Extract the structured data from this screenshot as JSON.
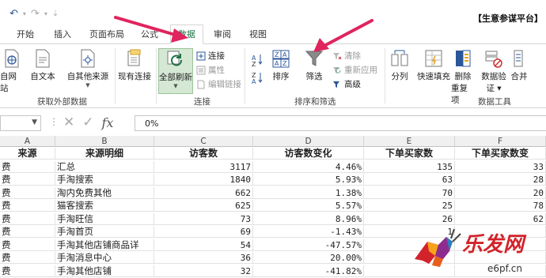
{
  "qat": {
    "undo": "↶",
    "redo": "↷",
    "customize": "⇣"
  },
  "app_title": "【生意参谋平台】",
  "tabs": [
    "开始",
    "插入",
    "页面布局",
    "公式",
    "数据",
    "审阅",
    "视图"
  ],
  "active_tab": "数据",
  "ribbon": {
    "get_external": {
      "buttons": [
        "自网站",
        "自文本",
        "自其他来源",
        "现有连接"
      ],
      "label": "获取外部数据"
    },
    "connections": {
      "refresh_all": "全部刷新",
      "connect": "连接",
      "properties": "属性",
      "edit_links": "编辑链接",
      "label": "连接"
    },
    "sort_filter": {
      "sort": "排序",
      "filter": "筛选",
      "clear": "清除",
      "reapply": "重新应用",
      "advanced": "高级",
      "label": "排序和筛选"
    },
    "data_tools": {
      "split": "分列",
      "flash_fill": "快速填充",
      "remove_dup_1": "删除",
      "remove_dup_2": "重复项",
      "validation_1": "数据验",
      "validation_2": "证 ▾",
      "consolidate": "合并",
      "label": "数据工具"
    }
  },
  "formula": {
    "value": "0%",
    "fx": "fx"
  },
  "columns": [
    "A",
    "B",
    "C",
    "D",
    "E",
    "F"
  ],
  "headers": [
    "来源",
    "来源明细",
    "访客数",
    "访客数变化",
    "下单买家数",
    "下单买家数变"
  ],
  "rows": [
    [
      "费",
      "汇总",
      "3117",
      "4.46%",
      "135",
      "33"
    ],
    [
      "费",
      "手淘搜索",
      "1840",
      "5.93%",
      "63",
      "28"
    ],
    [
      "费",
      "淘内免费其他",
      "662",
      "1.38%",
      "70",
      "20"
    ],
    [
      "费",
      "猫客搜索",
      "625",
      "5.57%",
      "25",
      "78"
    ],
    [
      "费",
      "手淘旺信",
      "73",
      "8.96%",
      "26",
      "62"
    ],
    [
      "费",
      "手淘首页",
      "69",
      "-1.43%",
      "1",
      ""
    ],
    [
      "费",
      "手淘其他店铺商品详",
      "54",
      "-47.57%",
      "",
      ""
    ],
    [
      "费",
      "手淘消息中心",
      "36",
      "20.00%",
      "",
      ""
    ],
    [
      "费",
      "手淘其他店铺",
      "32",
      "-41.82%",
      "",
      ""
    ]
  ],
  "watermark": {
    "text": "乐发网",
    "url": "e6pf.cn"
  },
  "colors": {
    "excel_green": "#217346",
    "arrow_red": "#e0245e",
    "accent_blue": "#2b579a"
  }
}
